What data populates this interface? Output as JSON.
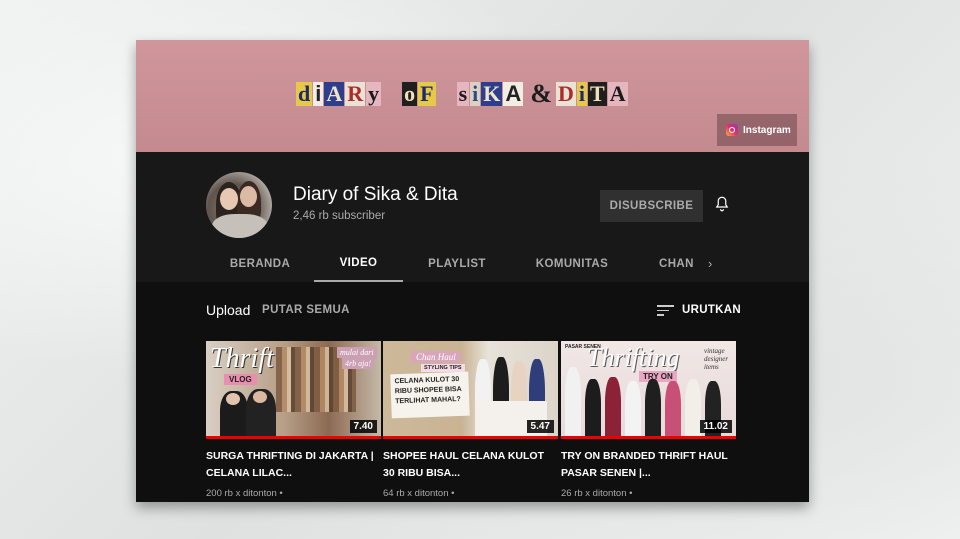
{
  "banner": {
    "title_words": [
      "diARy",
      "oF",
      "siKA",
      "DiTA"
    ],
    "ampersand": "&",
    "instagram_label": "Instagram"
  },
  "channel": {
    "name": "Diary of Sika & Dita",
    "subscribers": "2,46 rb subscriber",
    "unsubscribe_label": "DISUBSCRIBE"
  },
  "tabs": [
    {
      "label": "BERANDA",
      "active": false
    },
    {
      "label": "VIDEO",
      "active": true
    },
    {
      "label": "PLAYLIST",
      "active": false
    },
    {
      "label": "KOMUNITAS",
      "active": false
    },
    {
      "label": "CHAN",
      "active": false
    }
  ],
  "section": {
    "title": "Upload",
    "play_all": "PUTAR SEMUA",
    "sort_label": "URUTKAN"
  },
  "videos": [
    {
      "title": "SURGA THRIFTING DI JAKARTA | CELANA LILAC...",
      "meta": "200 rb x ditonton •",
      "duration": "7.40",
      "thumb_text": [
        "Thrift",
        "VLOG",
        "mulai dari",
        "4rb aja!"
      ]
    },
    {
      "title": "SHOPEE HAUL CELANA KULOT 30 RIBU BISA...",
      "meta": "64 rb x ditonton •",
      "duration": "5.47",
      "thumb_text": [
        "Chan Haul",
        "STYLING TIPS",
        "CELANA KULOT 30 RIBU SHOPEE BISA TERLIHAT MAHAL?"
      ]
    },
    {
      "title": "TRY ON BRANDED THRIFT HAUL PASAR SENEN |...",
      "meta": "26 rb x ditonton •",
      "duration": "11.02",
      "thumb_text": [
        "PASAR SENEN",
        "Thrifting",
        "TRY ON",
        "vintage designer items"
      ]
    }
  ],
  "colors": {
    "banner": "#c98f95",
    "background": "#181818",
    "progress": "#e00000"
  }
}
